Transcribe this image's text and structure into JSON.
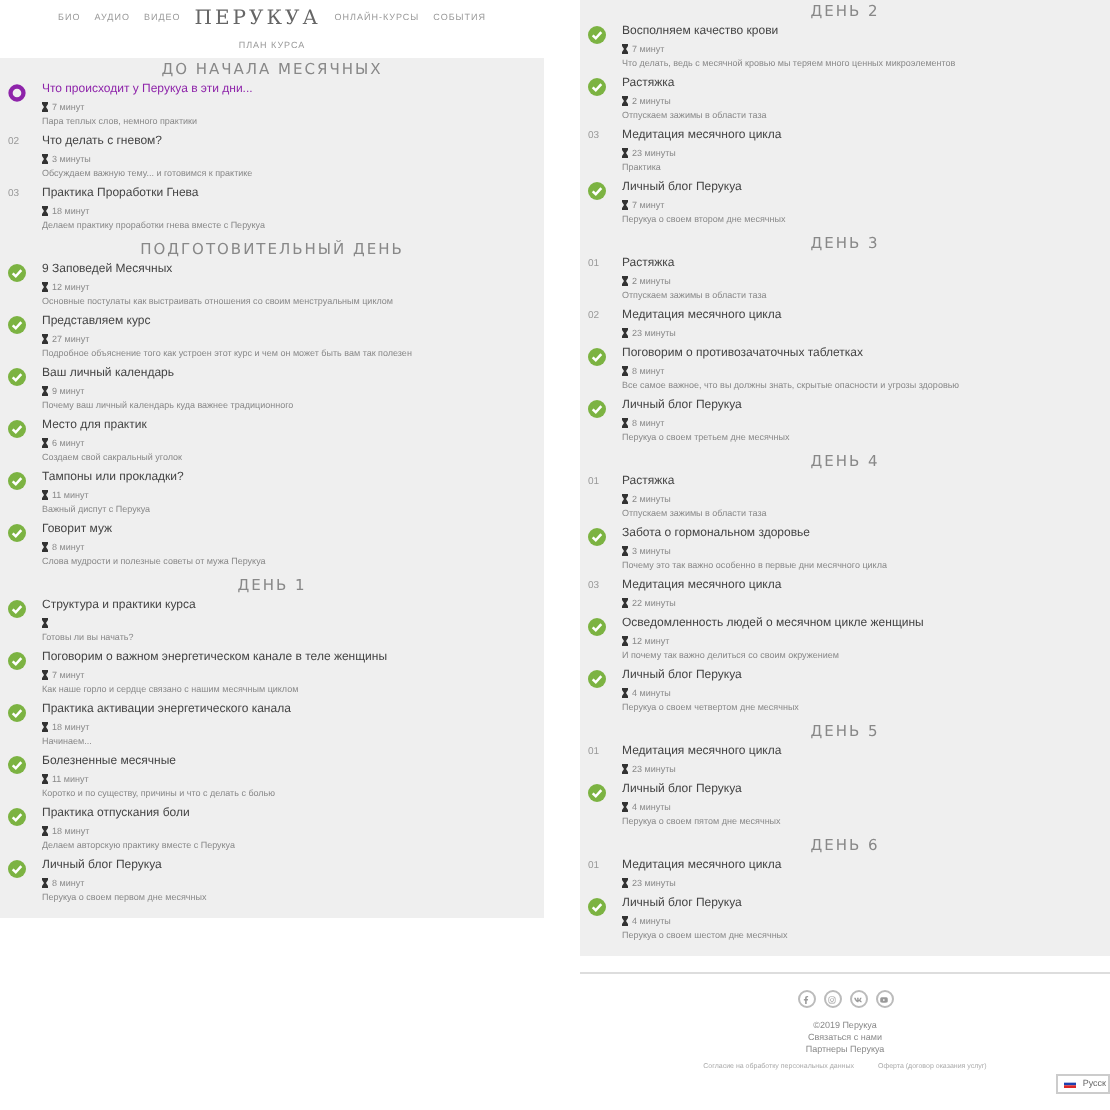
{
  "nav": {
    "links_left": [
      "БИО",
      "АУДИО",
      "ВИДЕО"
    ],
    "logo": "ПЕРУКУА",
    "links_right": [
      "ОНЛАЙН-КУРСЫ",
      "СОБЫТИЯ"
    ],
    "sub_link": "ПЛАН КУРСА"
  },
  "columns": [
    {
      "sections": [
        {
          "title": "ДО НАЧАЛА МЕСЯЧНЫХ",
          "lessons": [
            {
              "kind": "current",
              "title": "Что происходит у Перукуа в эти дни...",
              "duration": "7 минут",
              "description": "Пара теплых слов, немного практики"
            },
            {
              "kind": "todo",
              "number": "02",
              "title": "Что делать с гневом?",
              "duration": "3 минуты",
              "description": "Обсуждаем важную тему... и готовимся к практике"
            },
            {
              "kind": "todo",
              "number": "03",
              "title": "Практика Проработки Гнева",
              "duration": "18 минут",
              "description": "Делаем практику проработки гнева вместе с Перукуа"
            }
          ]
        },
        {
          "title": "ПОДГОТОВИТЕЛЬНЫЙ ДЕНЬ",
          "lessons": [
            {
              "kind": "done",
              "title": "9 Заповедей Месячных",
              "duration": "12 минут",
              "description": "Основные постулаты как выстраивать отношения со своим менструальным циклом"
            },
            {
              "kind": "done",
              "title": "Представляем курс",
              "duration": "27 минут",
              "description": "Подробное объяснение того как устроен этот курс и чем он может быть вам так полезен"
            },
            {
              "kind": "done",
              "title": "Ваш личный календарь",
              "duration": "9 минут",
              "description": "Почему ваш личный календарь куда важнее традиционного"
            },
            {
              "kind": "done",
              "title": "Место для практик",
              "duration": "6 минут",
              "description": "Создаем свой сакральный уголок"
            },
            {
              "kind": "done",
              "title": "Тампоны или прокладки?",
              "duration": "11 минут",
              "description": "Важный диспут с Перукуа"
            },
            {
              "kind": "done",
              "title": "Говорит муж",
              "duration": "8 минут",
              "description": "Слова мудрости и полезные советы от мужа Перукуа"
            }
          ]
        },
        {
          "title": "ДЕНЬ 1",
          "lessons": [
            {
              "kind": "done",
              "title": "Структура и практики курса",
              "description": "Готовы ли вы начать?"
            },
            {
              "kind": "done",
              "title": "Поговорим о важном энергетическом канале в теле женщины",
              "duration": "7 минут",
              "description": "Как наше горло и сердце связано с нашим месячным циклом"
            },
            {
              "kind": "done",
              "title": "Практика активации энергетического канала",
              "duration": "18 минут",
              "description": "Начинаем..."
            },
            {
              "kind": "done",
              "title": "Болезненные месячные",
              "duration": "11 минут",
              "description": "Коротко и по существу, причины и что с делать с болью"
            },
            {
              "kind": "done",
              "title": "Практика отпускания боли",
              "duration": "18 минут",
              "description": "Делаем авторскую практику вместе с Перукуа"
            },
            {
              "kind": "done",
              "title": "Личный блог Перукуа",
              "duration": "8 минут",
              "description": "Перукуа о своем первом дне месячных"
            }
          ]
        }
      ]
    },
    {
      "sections": [
        {
          "title": "ДЕНЬ 2",
          "lessons": [
            {
              "kind": "done",
              "title": "Восполняем качество крови",
              "duration": "7 минут",
              "description": "Что делать, ведь с месячной кровью мы теряем много ценных микроэлементов"
            },
            {
              "kind": "done",
              "title": "Растяжка",
              "duration": "2 минуты",
              "description": "Отпускаем зажимы в области таза"
            },
            {
              "kind": "todo",
              "number": "03",
              "title": "Медитация месячного цикла",
              "duration": "23 минуты",
              "description": "Практика"
            },
            {
              "kind": "done",
              "title": "Личный блог Перукуа",
              "duration": "7 минут",
              "description": "Перукуа о своем втором дне месячных"
            }
          ]
        },
        {
          "title": "ДЕНЬ 3",
          "lessons": [
            {
              "kind": "todo",
              "number": "01",
              "title": "Растяжка",
              "duration": "2 минуты",
              "description": "Отпускаем зажимы в области таза"
            },
            {
              "kind": "todo",
              "number": "02",
              "title": "Медитация месячного цикла",
              "duration": "23 минуты"
            },
            {
              "kind": "done",
              "title": "Поговорим о противозачаточных таблетках",
              "duration": "8 минут",
              "description": "Все самое важное, что вы должны знать, скрытые опасности и угрозы здоровью"
            },
            {
              "kind": "done",
              "title": "Личный блог Перукуа",
              "duration": "8 минут",
              "description": "Перукуа о своем третьем дне месячных"
            }
          ]
        },
        {
          "title": "ДЕНЬ 4",
          "lessons": [
            {
              "kind": "todo",
              "number": "01",
              "title": "Растяжка",
              "duration": "2 минуты",
              "description": "Отпускаем зажимы в области таза"
            },
            {
              "kind": "done",
              "title": "Забота о гормональном здоровье",
              "duration": "3 минуты",
              "description": "Почему это так важно особенно в первые дни месячного цикла"
            },
            {
              "kind": "todo",
              "number": "03",
              "title": "Медитация месячного цикла",
              "duration": "22 минуты"
            },
            {
              "kind": "done",
              "title": "Осведомленность людей о месячном цикле женщины",
              "duration": "12 минут",
              "description": "И почему так важно делиться со своим окружением"
            },
            {
              "kind": "done",
              "title": "Личный блог Перукуа",
              "duration": "4 минуты",
              "description": "Перукуа о своем четвертом дне месячных"
            }
          ]
        },
        {
          "title": "ДЕНЬ 5",
          "lessons": [
            {
              "kind": "todo",
              "number": "01",
              "title": "Медитация месячного цикла",
              "duration": "23 минуты"
            },
            {
              "kind": "done",
              "title": "Личный блог Перукуа",
              "duration": "4 минуты",
              "description": "Перукуа о своем пятом дне месячных"
            }
          ]
        },
        {
          "title": "ДЕНЬ 6",
          "lessons": [
            {
              "kind": "todo",
              "number": "01",
              "title": "Медитация месячного цикла",
              "duration": "23 минуты"
            },
            {
              "kind": "done",
              "title": "Личный блог Перукуа",
              "duration": "4 минуты",
              "description": "Перукуа о своем шестом дне месячных"
            }
          ]
        }
      ]
    }
  ],
  "footer": {
    "lines": [
      "©2019 Перукуа",
      "Связаться с нами",
      "Партнеры Перукуа"
    ],
    "legal": [
      "Согласие на обработку персональных данных",
      "Оферта (договор оказания услуг)"
    ],
    "language": "Русск"
  }
}
